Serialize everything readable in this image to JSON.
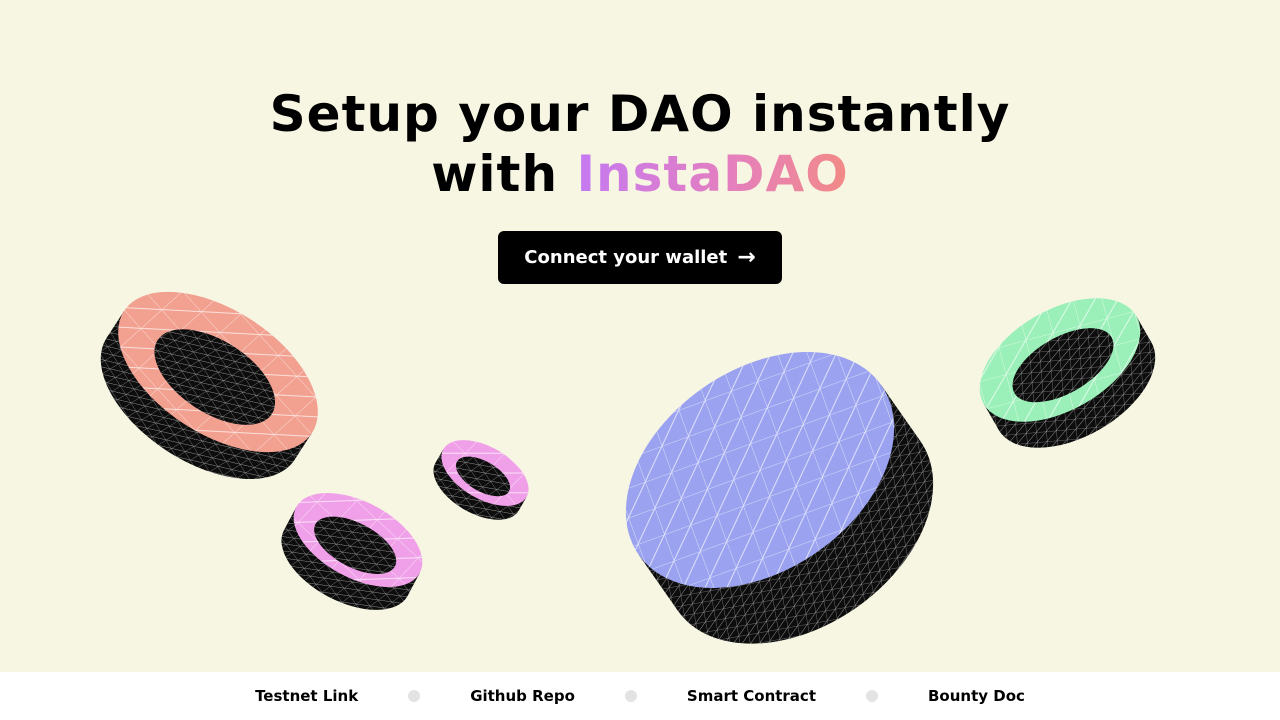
{
  "hero": {
    "title_line1": "Setup your DAO instantly",
    "title_with": "with ",
    "brand": "InstaDAO"
  },
  "cta": {
    "label": "Connect your wallet",
    "icon": "arrow-right-icon"
  },
  "decor": {
    "shapes": [
      {
        "name": "salmon-ring",
        "color": "#F2A090"
      },
      {
        "name": "pink-ring-large",
        "color": "#F0A0E8"
      },
      {
        "name": "pink-ring-small",
        "color": "#F0A0E8"
      },
      {
        "name": "blue-disc",
        "color": "#9BA3F0"
      },
      {
        "name": "green-ring",
        "color": "#9AF0B8"
      }
    ]
  },
  "footer": {
    "links": [
      "Testnet Link",
      "Github Repo",
      "Smart Contract",
      "Bounty Doc"
    ]
  },
  "colors": {
    "background": "#F7F6E3",
    "button": "#000000",
    "brand_gradient": [
      "#C57AF2",
      "#E47FC0",
      "#F28A86"
    ],
    "footer_dot": "#E3E3E3"
  }
}
